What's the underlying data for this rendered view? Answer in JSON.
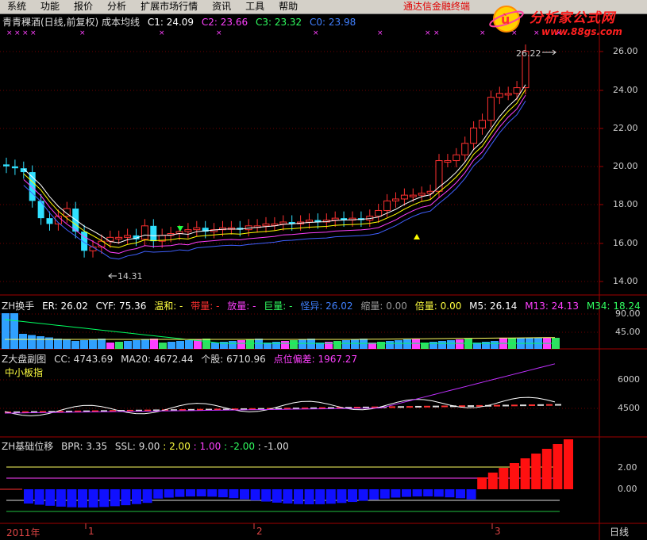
{
  "menu": {
    "items": [
      "系统",
      "功能",
      "报价",
      "分析",
      "扩展市场行情",
      "资讯",
      "工具",
      "帮助"
    ],
    "brand": "通达信金融终端"
  },
  "logo": {
    "name": "分析家公式网",
    "url": "www.88gs.com"
  },
  "main": {
    "title": "青青稞酒(日线,前复权) 成本均线",
    "c1_label": "C1: 24.09",
    "c2_label": "C2: 23.66",
    "c3_label": "C3: 23.32",
    "c0_label": "C0: 23.98",
    "axis": [
      "26.00",
      "24.00",
      "22.00",
      "20.00",
      "18.00",
      "16.00",
      "14.00"
    ],
    "high_label": "26.22",
    "low_label": "14.31"
  },
  "turnover": {
    "name": "ZH换手",
    "er": "ER: 26.02",
    "cyf": "CYF: 75.36",
    "wenhe": "温和: -",
    "dailiang": "带量: -",
    "fangliang": "放量: -",
    "juliang": "巨量: -",
    "guaiyi": "怪异: 26.02",
    "suoliang": "缩量: 0.00",
    "beiliang": "倍量: 0.00",
    "m5": "M5: 26.14",
    "m13": "M13: 24.13",
    "m34": "M34: 18.24",
    "axis": [
      "90.00",
      "45.00"
    ]
  },
  "market": {
    "name": "Z大盘副图",
    "cc": "CC: 4743.69",
    "ma20": "MA20: 4672.44",
    "gegu": "个股: 6710.96",
    "pianlian": "点位偏差: 1967.27",
    "index_name": "中小板指",
    "axis": [
      "6000",
      "4500"
    ]
  },
  "bpr": {
    "name": "ZH基础位移",
    "bpr": "BPR: 3.35",
    "ssl": "SSL: 9.00",
    "v1": ": 2.00",
    "v2": ": 1.00",
    "v3": ": -2.00",
    "v4": ": -1.00",
    "axis": [
      "2.00",
      "0.00"
    ]
  },
  "dates": {
    "year": "2011年",
    "m1": "1",
    "m2": "2",
    "m3": "3"
  },
  "period": "日线",
  "colors": {
    "up": "#ff3030",
    "down": "#30e0ff",
    "ma1": "#ffffff",
    "ma2": "#ffff00",
    "ma3": "#ff40ff",
    "ma4": "#4060ff",
    "grid": "#a00000"
  }
}
